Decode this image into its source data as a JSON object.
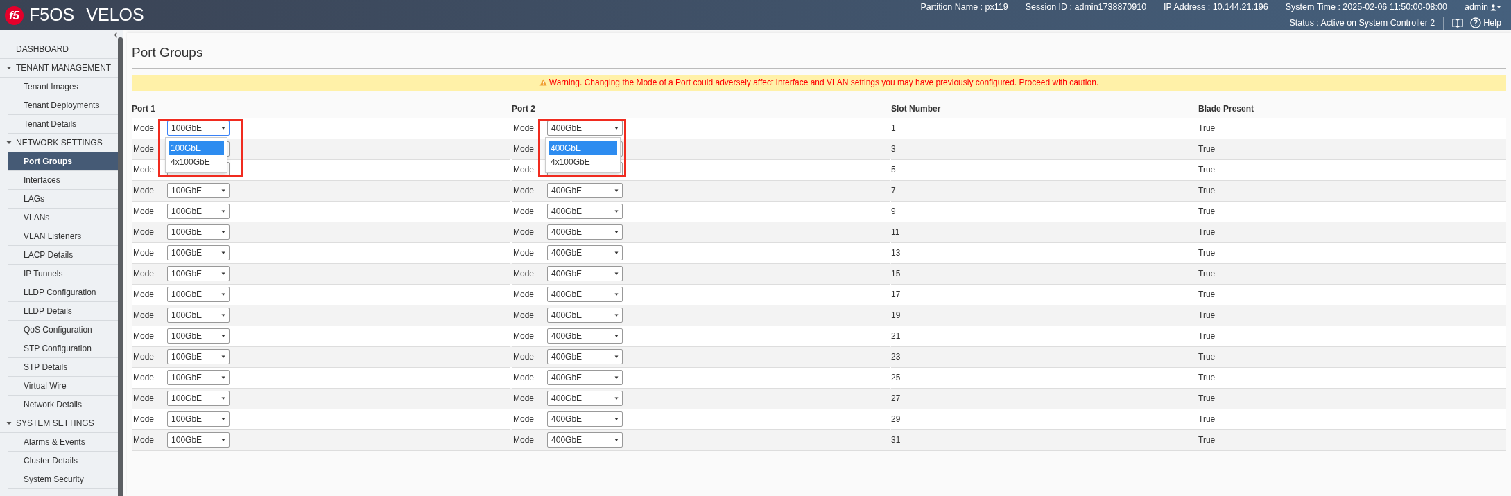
{
  "header": {
    "logo": "f5",
    "product": "F5OS",
    "platform": "VELOS",
    "info": [
      "Partition Name : px119",
      "Session ID : admin1738870910",
      "IP Address : 10.144.21.196",
      "System Time : 2025-02-06 11:50:00-08:00"
    ],
    "user": "admin",
    "status": "Status : Active on System Controller 2",
    "help": "Help"
  },
  "sidebar": {
    "items": [
      {
        "label": "DASHBOARD",
        "kind": "link"
      },
      {
        "label": "TENANT MANAGEMENT",
        "kind": "section",
        "expanded": true,
        "children": [
          {
            "label": "Tenant Images",
            "selected": false
          },
          {
            "label": "Tenant Deployments",
            "selected": false
          },
          {
            "label": "Tenant Details",
            "selected": false
          }
        ]
      },
      {
        "label": "NETWORK SETTINGS",
        "kind": "section",
        "expanded": true,
        "children": [
          {
            "label": "Port Groups",
            "selected": true
          },
          {
            "label": "Interfaces",
            "selected": false
          },
          {
            "label": "LAGs",
            "selected": false
          },
          {
            "label": "VLANs",
            "selected": false
          },
          {
            "label": "VLAN Listeners",
            "selected": false
          },
          {
            "label": "LACP Details",
            "selected": false
          },
          {
            "label": "IP Tunnels",
            "selected": false
          },
          {
            "label": "LLDP Configuration",
            "selected": false
          },
          {
            "label": "LLDP Details",
            "selected": false
          },
          {
            "label": "QoS Configuration",
            "selected": false
          },
          {
            "label": "STP Configuration",
            "selected": false
          },
          {
            "label": "STP Details",
            "selected": false
          },
          {
            "label": "Virtual Wire",
            "selected": false
          },
          {
            "label": "Network Details",
            "selected": false
          }
        ]
      },
      {
        "label": "SYSTEM SETTINGS",
        "kind": "section",
        "expanded": true,
        "children": [
          {
            "label": "Alarms & Events",
            "selected": false
          },
          {
            "label": "Cluster Details",
            "selected": false
          },
          {
            "label": "System Security",
            "selected": false
          }
        ]
      }
    ]
  },
  "page": {
    "title": "Port Groups",
    "warning": "Warning. Changing the Mode of a Port could adversely affect Interface and VLAN settings you may have previously configured. Proceed with caution."
  },
  "table": {
    "columns": [
      "Port 1",
      "Port 2",
      "Slot Number",
      "Blade Present"
    ],
    "rows": [
      {
        "port_1": {
          "label": "Mode",
          "value": "100GbE",
          "focused": true,
          "open": true,
          "annotated": true,
          "options": [
            {
              "label": "100GbE",
              "selected": true
            },
            {
              "label": "4x100GbE",
              "selected": false
            }
          ]
        },
        "port_2": {
          "label": "Mode",
          "value": "400GbE",
          "focused": false,
          "open": true,
          "annotated": true,
          "options": [
            {
              "label": "400GbE",
              "selected": true
            },
            {
              "label": "4x100GbE",
              "selected": false
            }
          ]
        },
        "slot": "1",
        "blade_present": "True"
      },
      {
        "port_1": {
          "label": "Mode",
          "focused": false,
          "open": false,
          "annotated": false
        },
        "port_2": {
          "label": "Mode",
          "focused": false,
          "open": false,
          "annotated": false
        },
        "slot": "3",
        "blade_present": "True"
      },
      {
        "port_1": {
          "label": "Mode",
          "focused": false,
          "open": false,
          "annotated": false
        },
        "port_2": {
          "label": "Mode",
          "focused": false,
          "open": false,
          "annotated": false
        },
        "slot": "5",
        "blade_present": "True"
      },
      {
        "port_1": {
          "label": "Mode",
          "value": "100GbE",
          "focused": false,
          "open": false,
          "annotated": false
        },
        "port_2": {
          "label": "Mode",
          "value": "400GbE",
          "focused": false,
          "open": false,
          "annotated": false
        },
        "slot": "7",
        "blade_present": "True"
      },
      {
        "port_1": {
          "label": "Mode",
          "value": "100GbE",
          "focused": false,
          "open": false,
          "annotated": false
        },
        "port_2": {
          "label": "Mode",
          "value": "400GbE",
          "focused": false,
          "open": false,
          "annotated": false
        },
        "slot": "9",
        "blade_present": "True"
      },
      {
        "port_1": {
          "label": "Mode",
          "value": "100GbE",
          "focused": false,
          "open": false,
          "annotated": false
        },
        "port_2": {
          "label": "Mode",
          "value": "400GbE",
          "focused": false,
          "open": false,
          "annotated": false
        },
        "slot": "11",
        "blade_present": "True"
      },
      {
        "port_1": {
          "label": "Mode",
          "value": "100GbE",
          "focused": false,
          "open": false,
          "annotated": false
        },
        "port_2": {
          "label": "Mode",
          "value": "400GbE",
          "focused": false,
          "open": false,
          "annotated": false
        },
        "slot": "13",
        "blade_present": "True"
      },
      {
        "port_1": {
          "label": "Mode",
          "value": "100GbE",
          "focused": false,
          "open": false,
          "annotated": false
        },
        "port_2": {
          "label": "Mode",
          "value": "400GbE",
          "focused": false,
          "open": false,
          "annotated": false
        },
        "slot": "15",
        "blade_present": "True"
      },
      {
        "port_1": {
          "label": "Mode",
          "value": "100GbE",
          "focused": false,
          "open": false,
          "annotated": false
        },
        "port_2": {
          "label": "Mode",
          "value": "400GbE",
          "focused": false,
          "open": false,
          "annotated": false
        },
        "slot": "17",
        "blade_present": "True"
      },
      {
        "port_1": {
          "label": "Mode",
          "value": "100GbE",
          "focused": false,
          "open": false,
          "annotated": false
        },
        "port_2": {
          "label": "Mode",
          "value": "400GbE",
          "focused": false,
          "open": false,
          "annotated": false
        },
        "slot": "19",
        "blade_present": "True"
      },
      {
        "port_1": {
          "label": "Mode",
          "value": "100GbE",
          "focused": false,
          "open": false,
          "annotated": false
        },
        "port_2": {
          "label": "Mode",
          "value": "400GbE",
          "focused": false,
          "open": false,
          "annotated": false
        },
        "slot": "21",
        "blade_present": "True"
      },
      {
        "port_1": {
          "label": "Mode",
          "value": "100GbE",
          "focused": false,
          "open": false,
          "annotated": false
        },
        "port_2": {
          "label": "Mode",
          "value": "400GbE",
          "focused": false,
          "open": false,
          "annotated": false
        },
        "slot": "23",
        "blade_present": "True"
      },
      {
        "port_1": {
          "label": "Mode",
          "value": "100GbE",
          "focused": false,
          "open": false,
          "annotated": false
        },
        "port_2": {
          "label": "Mode",
          "value": "400GbE",
          "focused": false,
          "open": false,
          "annotated": false
        },
        "slot": "25",
        "blade_present": "True"
      },
      {
        "port_1": {
          "label": "Mode",
          "value": "100GbE",
          "focused": false,
          "open": false,
          "annotated": false
        },
        "port_2": {
          "label": "Mode",
          "value": "400GbE",
          "focused": false,
          "open": false,
          "annotated": false
        },
        "slot": "27",
        "blade_present": "True"
      },
      {
        "port_1": {
          "label": "Mode",
          "value": "100GbE",
          "focused": false,
          "open": false,
          "annotated": false
        },
        "port_2": {
          "label": "Mode",
          "value": "400GbE",
          "focused": false,
          "open": false,
          "annotated": false
        },
        "slot": "29",
        "blade_present": "True"
      },
      {
        "port_1": {
          "label": "Mode",
          "value": "100GbE",
          "focused": false,
          "open": false,
          "annotated": false
        },
        "port_2": {
          "label": "Mode",
          "value": "400GbE",
          "focused": false,
          "open": false,
          "annotated": false
        },
        "slot": "31",
        "blade_present": "True"
      }
    ]
  }
}
